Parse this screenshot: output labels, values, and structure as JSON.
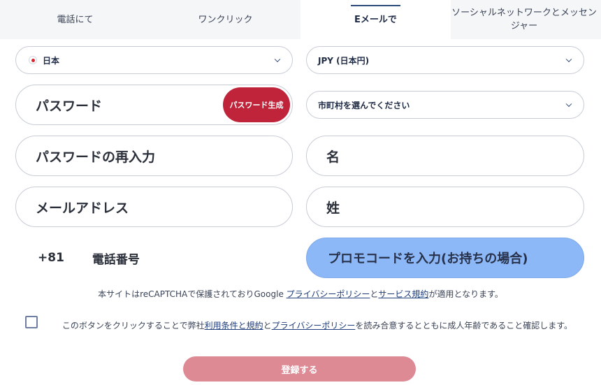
{
  "tabs": {
    "phone": "電話にて",
    "oneclick": "ワンクリック",
    "email": "Eメールで",
    "social": "ソーシャルネットワークとメッセンジャー"
  },
  "form": {
    "country": "日本",
    "currency": "JPY (日本円)",
    "city": "市町村を選んでください",
    "password_placeholder": "パスワード",
    "generate_password": "パスワード生成",
    "repeat_password_placeholder": "パスワードの再入力",
    "first_name_placeholder": "名",
    "email_placeholder": "メールアドレス",
    "last_name_placeholder": "姓",
    "phone_code": "+81",
    "phone_placeholder": "電話番号",
    "promo_placeholder": "プロモコードを入力(お持ちの場合)"
  },
  "recaptcha": {
    "prefix": "本サイトはreCAPTCHAで保護されておりGoogle ",
    "privacy_link": "プライバシーポリシー",
    "and": "と",
    "terms_link": "サービス規約",
    "suffix": "が適用となります。"
  },
  "terms": {
    "prefix": "このボタンをクリックすることで弊社",
    "terms_link": "利用条件と規約",
    "and": "と",
    "privacy_link": "プライバシーポリシー",
    "suffix": "を読み合意するとともに成人年齢であること確認します。"
  },
  "register_label": "登録する",
  "colors": {
    "accent_red": "#c0243a",
    "register_button": "#de8a95",
    "promo_fill": "#8db8f7",
    "link": "#1e3d7a"
  }
}
